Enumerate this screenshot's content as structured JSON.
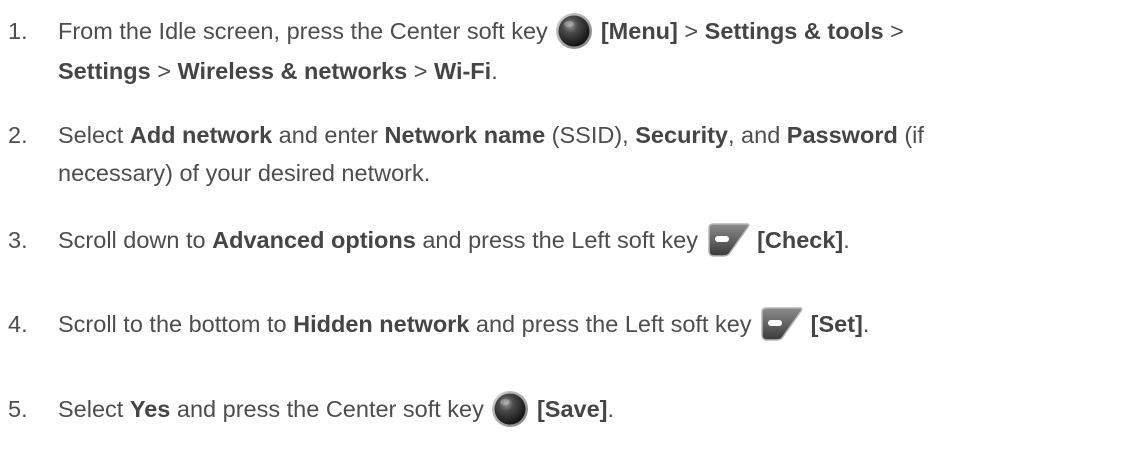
{
  "steps": [
    {
      "number": "1.",
      "t1": "From the Idle screen, press the Center soft key",
      "icon": "center-soft-key-icon",
      "b1": "[Menu]",
      "t2": " > ",
      "b2": "Settings & tools",
      "t3": " >",
      "b3": "Settings",
      "t4": " > ",
      "b4": "Wireless & networks",
      "t5": " > ",
      "b5": "Wi-Fi",
      "t6": "."
    },
    {
      "number": "2.",
      "t1": "Select ",
      "b1": "Add network",
      "t2": " and enter ",
      "b2": "Network name",
      "t3": " (SSID), ",
      "b3": "Security",
      "t4": ", and ",
      "b4": "Password",
      "t5": " (if",
      "t6": "necessary) of your desired network."
    },
    {
      "number": "3.",
      "t1": "Scroll down to ",
      "b1": "Advanced options",
      "t2": " and press the Left soft key",
      "icon": "left-soft-key-icon",
      "b2": "[Check]",
      "t3": "."
    },
    {
      "number": "4.",
      "t1": "Scroll to the bottom to ",
      "b1": "Hidden network",
      "t2": " and press the Left soft key",
      "icon": "left-soft-key-icon",
      "b2": "[Set]",
      "t3": "."
    },
    {
      "number": "5.",
      "t1": "Select ",
      "b1": "Yes",
      "t2": " and press the Center soft key",
      "icon": "center-soft-key-icon",
      "b2": "[Save]",
      "t3": "."
    }
  ]
}
